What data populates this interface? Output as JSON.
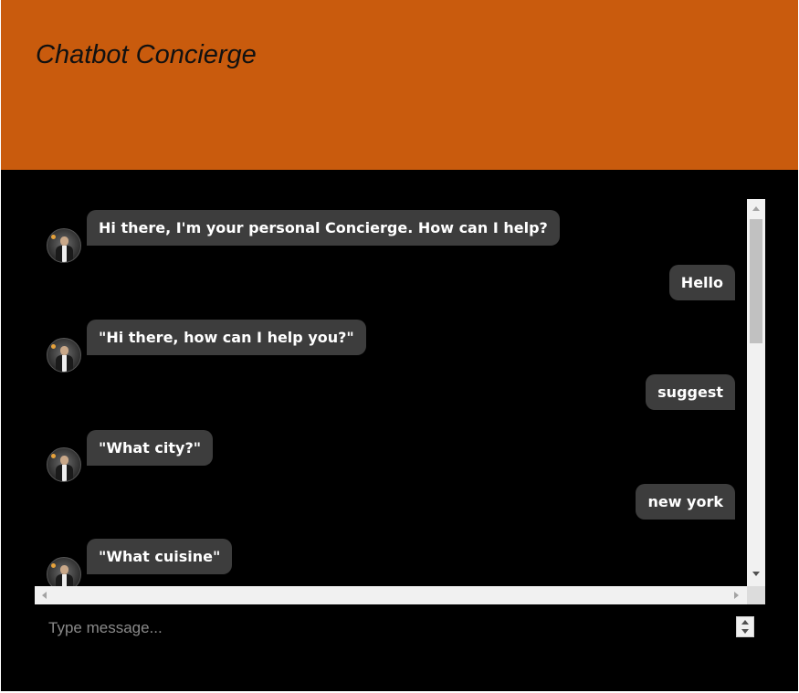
{
  "app": {
    "title": "Chatbot Concierge"
  },
  "colors": {
    "header_bg": "#c95b0d",
    "page_bg": "#000000",
    "bubble_bg": "#3d3d3d",
    "bubble_text": "#ffffff"
  },
  "chat": {
    "messages": [
      {
        "sender": "bot",
        "text": "Hi there, I'm your personal Concierge. How can I help?"
      },
      {
        "sender": "user",
        "text": "Hello"
      },
      {
        "sender": "bot",
        "text": "\"Hi there, how can I help you?\""
      },
      {
        "sender": "user",
        "text": "suggest"
      },
      {
        "sender": "bot",
        "text": "\"What city?\""
      },
      {
        "sender": "user",
        "text": "new york"
      },
      {
        "sender": "bot",
        "text": "\"What cuisine\""
      }
    ]
  },
  "composer": {
    "placeholder": "Type message..."
  }
}
